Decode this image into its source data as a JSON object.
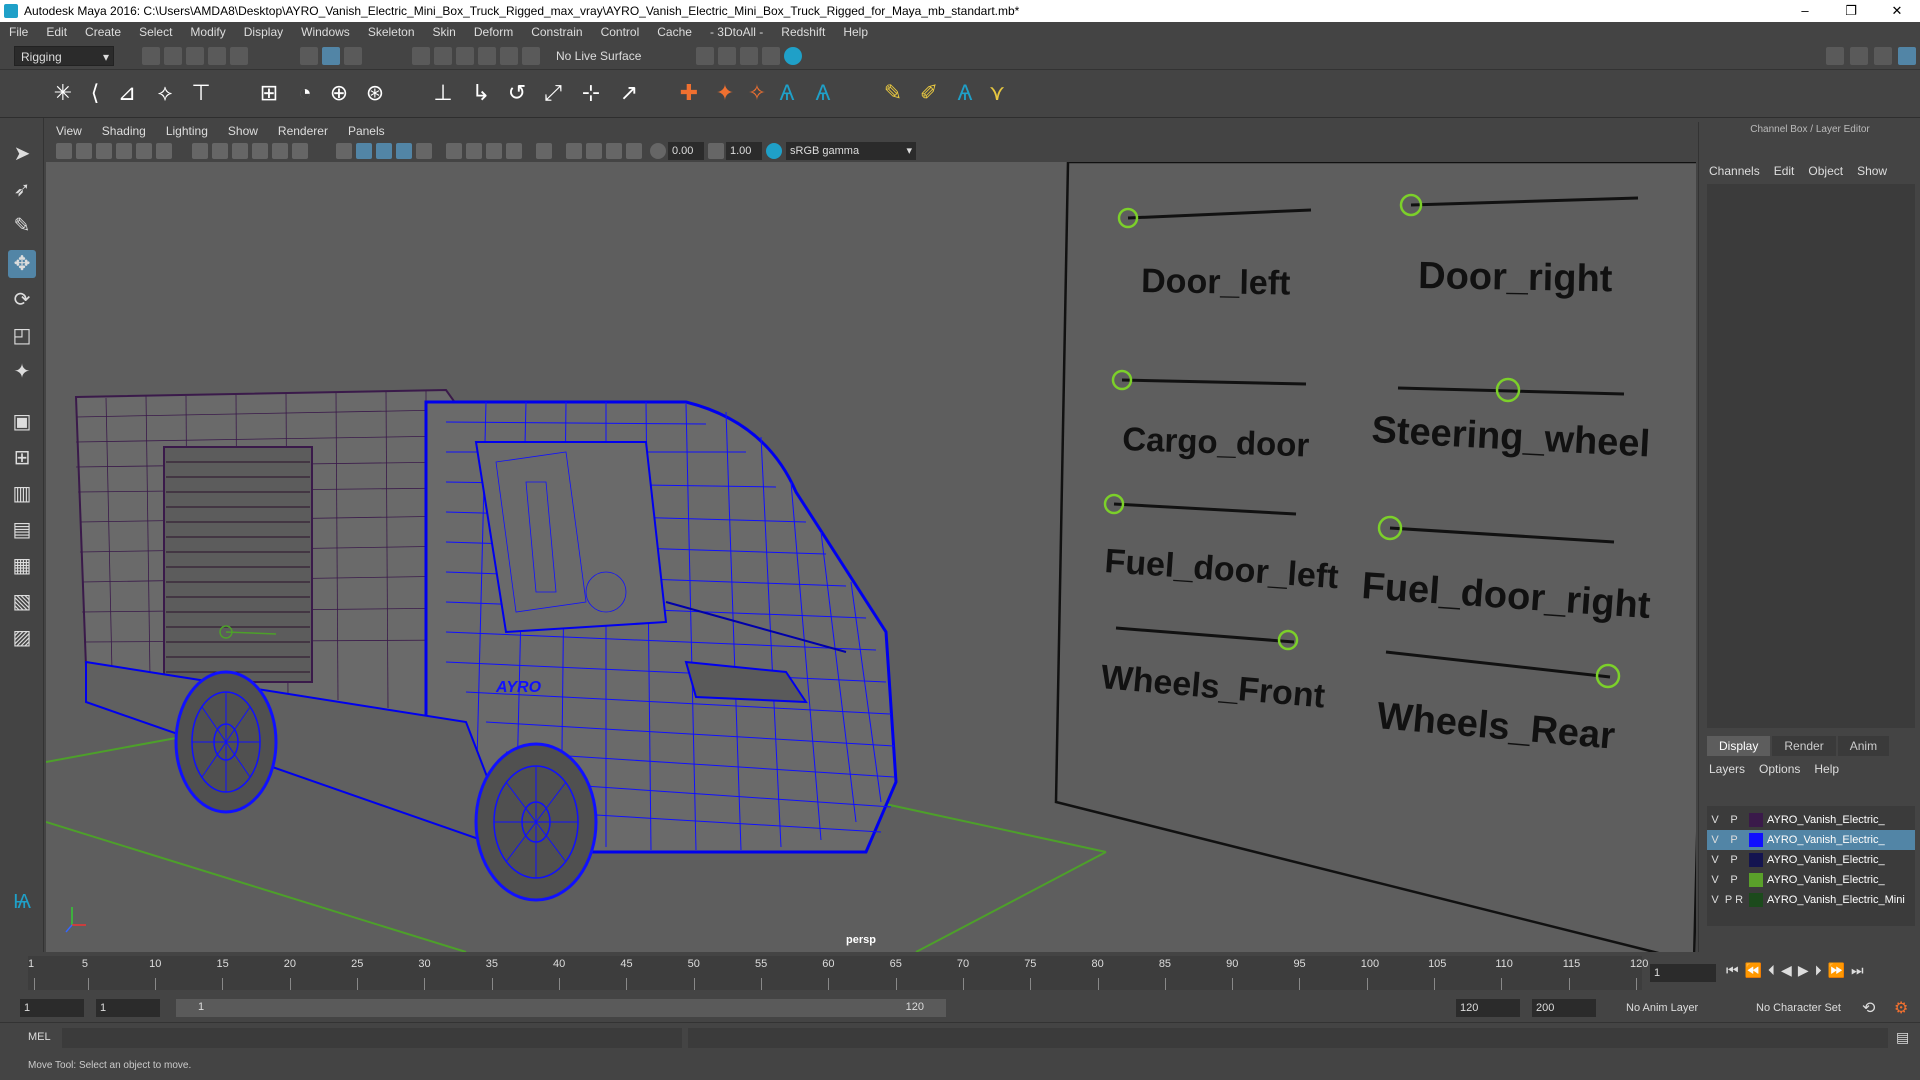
{
  "window": {
    "title": "Autodesk Maya 2016: C:\\Users\\AMDA8\\Desktop\\AYRO_Vanish_Electric_Mini_Box_Truck_Rigged_max_vray\\AYRO_Vanish_Electric_Mini_Box_Truck_Rigged_for_Maya_mb_standart.mb*",
    "minimize": "–",
    "maximize": "❐",
    "close": "✕"
  },
  "menu": [
    "File",
    "Edit",
    "Create",
    "Select",
    "Modify",
    "Display",
    "Windows",
    "Skeleton",
    "Skin",
    "Deform",
    "Constrain",
    "Control",
    "Cache",
    "- 3DtoAll -",
    "Redshift",
    "Help"
  ],
  "status": {
    "mode": "Rigging",
    "live_surface": "No Live Surface"
  },
  "panel_menu": [
    "View",
    "Shading",
    "Lighting",
    "Show",
    "Renderer",
    "Panels"
  ],
  "panel_toolbar": {
    "exposure": "0.00",
    "gamma": "1.00",
    "color_space": "sRGB gamma"
  },
  "viewport": {
    "camera": "persp",
    "rig_labels": [
      "Door_left",
      "Door_right",
      "Cargo_door",
      "Steering_wheel",
      "Fuel_door_left",
      "Fuel_door_right",
      "Wheels_Front",
      "Wheels_Rear"
    ],
    "brand_text": "AYRO"
  },
  "right_panel": {
    "title": "Channel Box / Layer Editor",
    "tabs": [
      "Channels",
      "Edit",
      "Object",
      "Show"
    ],
    "layer_tabs": [
      "Display",
      "Render",
      "Anim"
    ],
    "layer_menu": [
      "Layers",
      "Options",
      "Help"
    ],
    "layers": [
      {
        "v": "V",
        "p": "P",
        "name": "AYRO_Vanish_Electric_",
        "color": "#3a1a4a"
      },
      {
        "v": "V",
        "p": "P",
        "name": "AYRO_Vanish_Electric_",
        "color": "#1010ff"
      },
      {
        "v": "V",
        "p": "P",
        "name": "AYRO_Vanish_Electric_",
        "color": "#141450"
      },
      {
        "v": "V",
        "p": "P",
        "name": "AYRO_Vanish_Electric_",
        "color": "#5aa02a"
      },
      {
        "v": "V",
        "p": "P R",
        "name": "AYRO_Vanish_Electric_Mini",
        "color": "#1c4a1c"
      }
    ]
  },
  "timeline": {
    "ticks": [
      "1",
      "5",
      "10",
      "15",
      "20",
      "25",
      "30",
      "35",
      "40",
      "45",
      "50",
      "55",
      "60",
      "65",
      "70",
      "75",
      "80",
      "85",
      "90",
      "95",
      "100",
      "105",
      "110",
      "115",
      "120"
    ],
    "current_frame": "1"
  },
  "range": {
    "start": "1",
    "playback_start": "1",
    "slider_start": "1",
    "slider_end": "120",
    "playback_end": "120",
    "end": "200",
    "anim_layer": "No Anim Layer",
    "character_set": "No Character Set"
  },
  "command": {
    "lang": "MEL"
  },
  "help_line": "Move Tool: Select an object to move."
}
